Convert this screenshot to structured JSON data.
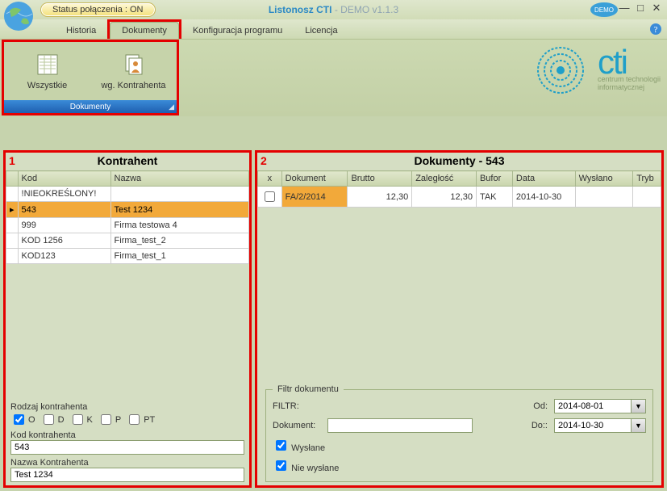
{
  "title": {
    "app": "Listonosz CTI",
    "suffix": " - DEMO v1.1.3"
  },
  "status": {
    "label": "Status połączenia : ON"
  },
  "window": {
    "min": "—",
    "max": "□",
    "close": "✕"
  },
  "demo_badge": "DEMO",
  "menu": {
    "historia": "Historia",
    "dokumenty": "Dokumenty",
    "konfiguracja": "Konfiguracja programu",
    "licencja": "Licencja"
  },
  "ribbon": {
    "wszystkie": "Wszystkie",
    "wg_kontrahenta": "wg. Kontrahenta",
    "group_caption": "Dokumenty"
  },
  "brand": {
    "name": "cti",
    "tag1": "centrum technologii",
    "tag2": "informatycznej"
  },
  "panel_left": {
    "num": "1",
    "title": "Kontrahent",
    "cols": {
      "kod": "Kod",
      "nazwa": "Nazwa"
    },
    "rows": [
      {
        "kod": "!NIEOKREŚLONY!",
        "nazwa": ""
      },
      {
        "kod": "543",
        "nazwa": "Test 1234"
      },
      {
        "kod": "999",
        "nazwa": "Firma testowa 4"
      },
      {
        "kod": "KOD 1256",
        "nazwa": "Firma_test_2"
      },
      {
        "kod": "KOD123",
        "nazwa": "Firma_test_1"
      }
    ],
    "filters": {
      "rodzaj_label": "Rodzaj kontrahenta",
      "types": {
        "o": "O",
        "d": "D",
        "k": "K",
        "p": "P",
        "pt": "PT"
      },
      "kod_label": "Kod kontrahenta",
      "kod_value": "543",
      "nazwa_label": "Nazwa Kontrahenta",
      "nazwa_value": "Test 1234"
    }
  },
  "panel_right": {
    "num": "2",
    "title": "Dokumenty - 543",
    "cols": {
      "x": "x",
      "dokument": "Dokument",
      "brutto": "Brutto",
      "zaleglosc": "Zaległość",
      "bufor": "Bufor",
      "data": "Data",
      "wyslano": "Wysłano",
      "tryb": "Tryb"
    },
    "rows": [
      {
        "dokument": "FA/2/2014",
        "brutto": "12,30",
        "zaleglosc": "12,30",
        "bufor": "TAK",
        "data": "2014-10-30",
        "wyslano": "",
        "tryb": ""
      }
    ],
    "filters": {
      "legend": "Filtr dokumentu",
      "filtr_label": "FILTR:",
      "dokument_label": "Dokument:",
      "dokument_value": "",
      "wyslane": "Wysłane",
      "niewyslane": "Nie wysłane",
      "od_label": "Od:",
      "od_value": "2014-08-01",
      "do_label": "Do::",
      "do_value": "2014-10-30",
      "dropdown_glyph": "▼"
    }
  }
}
